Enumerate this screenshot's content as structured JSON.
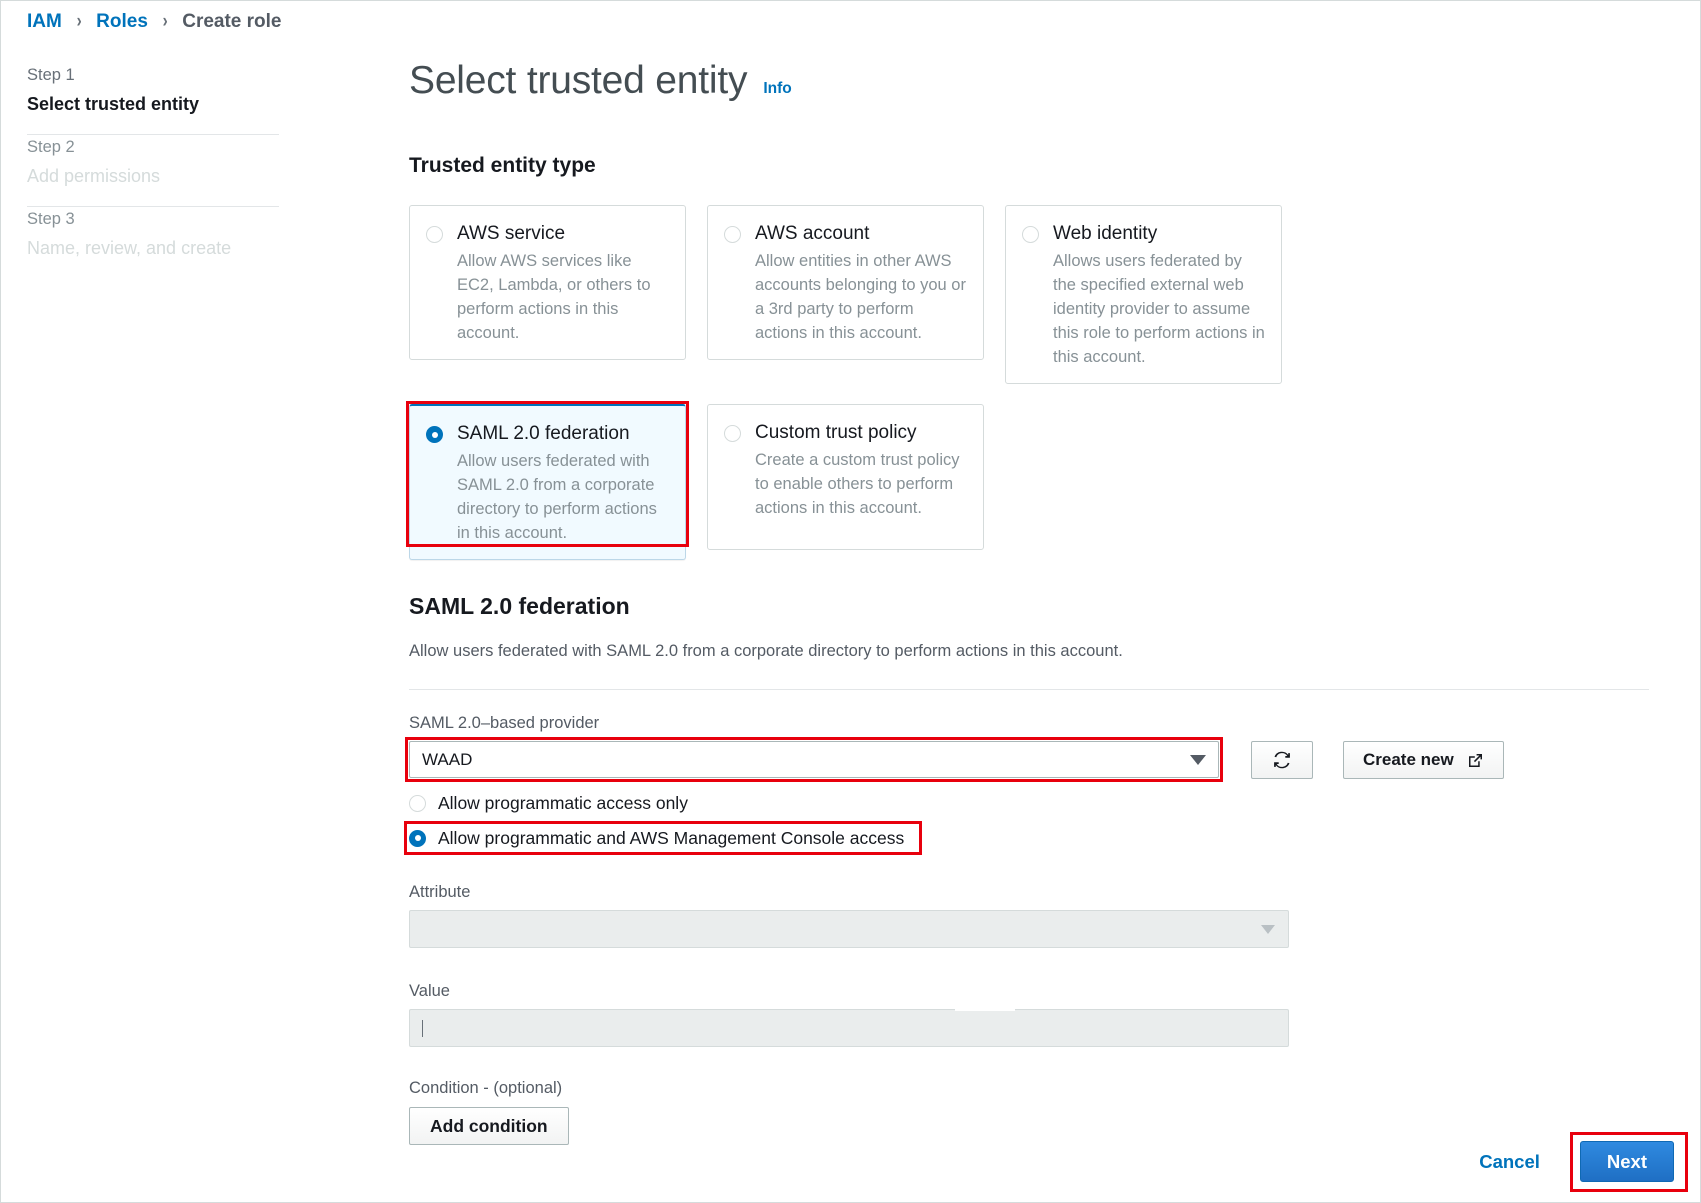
{
  "breadcrumb": {
    "items": [
      {
        "label": "IAM",
        "type": "link"
      },
      {
        "label": "Roles",
        "type": "link"
      },
      {
        "label": "Create role",
        "type": "current"
      }
    ],
    "separator": "›"
  },
  "sidebar": {
    "steps": [
      {
        "number": "Step 1",
        "name": "Select trusted entity",
        "state": "active"
      },
      {
        "number": "Step 2",
        "name": "Add permissions",
        "state": "inactive"
      },
      {
        "number": "Step 3",
        "name": "Name, review, and create",
        "state": "inactive"
      }
    ]
  },
  "main": {
    "page_title": "Select trusted entity",
    "info_link": "Info",
    "section_heading": "Trusted entity type",
    "tiles": [
      {
        "title": "AWS service",
        "description": "Allow AWS services like EC2, Lambda, or others to perform actions in this account.",
        "selected": false,
        "highlighted": false
      },
      {
        "title": "AWS account",
        "description": "Allow entities in other AWS accounts belonging to you or a 3rd party to perform actions in this account.",
        "selected": false,
        "highlighted": false
      },
      {
        "title": "Web identity",
        "description": "Allows users federated by the specified external web identity provider to assume this role to perform actions in this account.",
        "selected": false,
        "highlighted": false
      },
      {
        "title": "SAML 2.0 federation",
        "description": "Allow users federated with SAML 2.0 from a corporate directory to perform actions in this account.",
        "selected": true,
        "highlighted": true
      },
      {
        "title": "Custom trust policy",
        "description": "Create a custom trust policy to enable others to perform actions in this account.",
        "selected": false,
        "highlighted": false
      }
    ],
    "saml_section": {
      "heading": "SAML 2.0 federation",
      "description": "Allow users federated with SAML 2.0 from a corporate directory to perform actions in this account.",
      "provider_label": "SAML 2.0–based provider",
      "provider_value": "WAAD",
      "refresh_icon": "refresh-icon",
      "create_new_label": "Create new",
      "create_new_icon": "external-link-icon",
      "access_options": [
        {
          "label": "Allow programmatic access only",
          "selected": false,
          "highlighted": false
        },
        {
          "label": "Allow programmatic and AWS Management Console access",
          "selected": true,
          "highlighted": true
        }
      ],
      "attribute_label": "Attribute",
      "attribute_value": "",
      "value_label": "Value",
      "value_value": "",
      "condition_label": "Condition - (optional)",
      "add_condition_label": "Add condition"
    }
  },
  "footer": {
    "cancel_label": "Cancel",
    "next_label": "Next"
  },
  "colors": {
    "link": "#0073bb",
    "accent": "#0073bb",
    "highlight": "#e8000d",
    "primary_button": "#2f8ae0",
    "selected_tile_bg": "#f1faff"
  }
}
